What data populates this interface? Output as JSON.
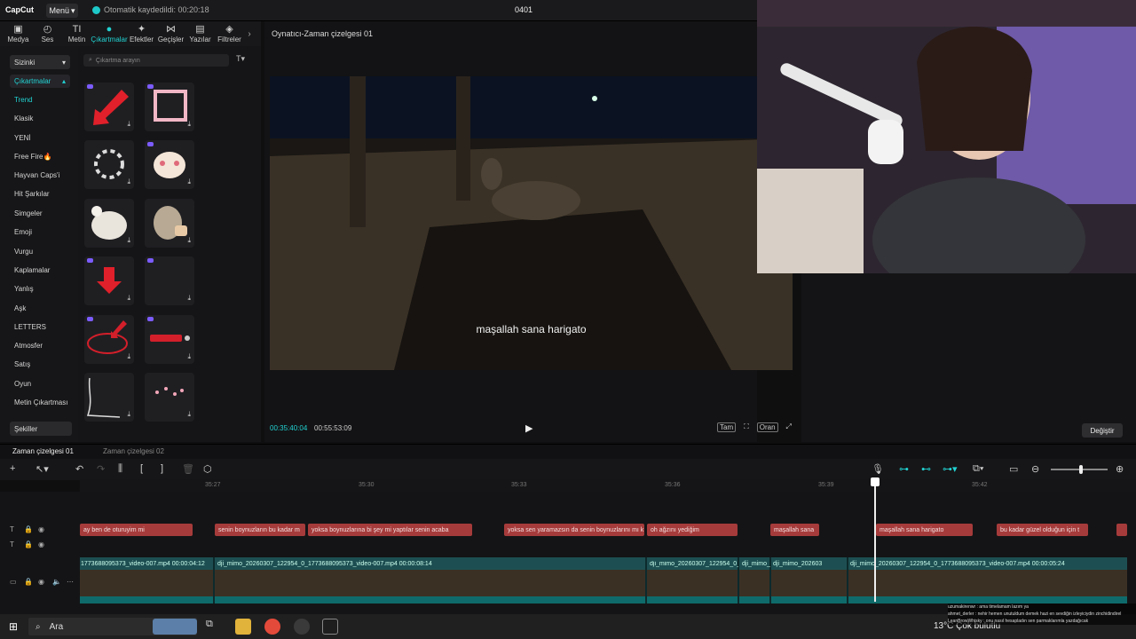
{
  "app": {
    "logo": "CapCut",
    "menu_label": "Menü",
    "autosave": "Otomatik kaydedildi: 00:20:18",
    "project_name": "0401"
  },
  "tabs": [
    {
      "icon": "media-icon",
      "label": "Medya"
    },
    {
      "icon": "audio-icon",
      "label": "Ses"
    },
    {
      "icon": "text-icon",
      "label": "Metin"
    },
    {
      "icon": "sticker-icon",
      "label": "Çıkartmalar",
      "active": true
    },
    {
      "icon": "effects-icon",
      "label": "Efektler"
    },
    {
      "icon": "transitions-icon",
      "label": "Geçişler"
    },
    {
      "icon": "captions-icon",
      "label": "Yazılar"
    },
    {
      "icon": "filters-icon",
      "label": "Filtreler"
    }
  ],
  "sidebar": {
    "select_label": "Sizinki",
    "section_label": "Çıkartmalar",
    "items": [
      "Trend",
      "Klasik",
      "YENİ",
      "Free Fire🔥",
      "Hayvan Caps'i",
      "Hit Şarkılar",
      "Simgeler",
      "Emoji",
      "Vurgu",
      "Kaplamalar",
      "Yanlış",
      "Aşk",
      "LETTERS",
      "Atmosfer",
      "Satış",
      "Oyun",
      "Metin Çıkartması"
    ],
    "shapes_label": "Şekiller"
  },
  "sticker_search": {
    "placeholder": "Çıkartma arayın"
  },
  "player": {
    "title": "Oynatıcı-Zaman çizelgesi 01",
    "subtitle_text": "maşallah sana harigato",
    "current_time": "00:35:40:04",
    "total_time": "00:55:53:09",
    "controls": [
      "Tam",
      "Oran"
    ]
  },
  "right_panel": {
    "change_button": "Değiştir"
  },
  "timeline": {
    "tab_active": "Zaman çizelgesi 01",
    "tab_inactive": "Zaman çizelgesi 02",
    "ruler_ticks": [
      "35:27",
      "35:30",
      "35:33",
      "35:36",
      "35:39",
      "35:42"
    ],
    "captions": [
      "ay ben de oturuyim mi",
      "senin boynuzların bu kadar m",
      "yoksa boynuzlarına bi şey mi yaptılar senin acaba",
      "yoksa sen yaramazsın da senin boynuzlarını mı k",
      "oh ağzını yediğim",
      "maşallah sana",
      "maşallah sana harigato",
      "bu kadar güzel olduğun için t"
    ],
    "video_labels": [
      "1773688095373_video-007.mp4  00:00:04:12",
      "dji_mimo_20260307_122954_0_1773688095373_video-007.mp4  00:00:08:14",
      "dji_mimo_20260307_122954_0_1",
      "dji_mimo_",
      "dji_mimo_202603",
      "dji_mimo_20260307_122954_0_1773688095373_video-007.mp4  00:00:05:24"
    ]
  },
  "taskbar": {
    "search_label": "Ara",
    "weather": "13°C Çok bulutlu",
    "chat": [
      "uzumakirenwr : ama timelamam lazım ya",
      "ahmet_derler : nehir hemen unutuldum demek hazi en sevdiğin izleyiciydin zinchidindirel",
      "LeanBrowWhisky : onu nasıl hesapladın sen parmaklarımla yazdağıcak"
    ]
  },
  "colors": {
    "accent": "#22d3d3",
    "caption_clip": "#a63b3b",
    "video_track": "#1d4f52"
  }
}
